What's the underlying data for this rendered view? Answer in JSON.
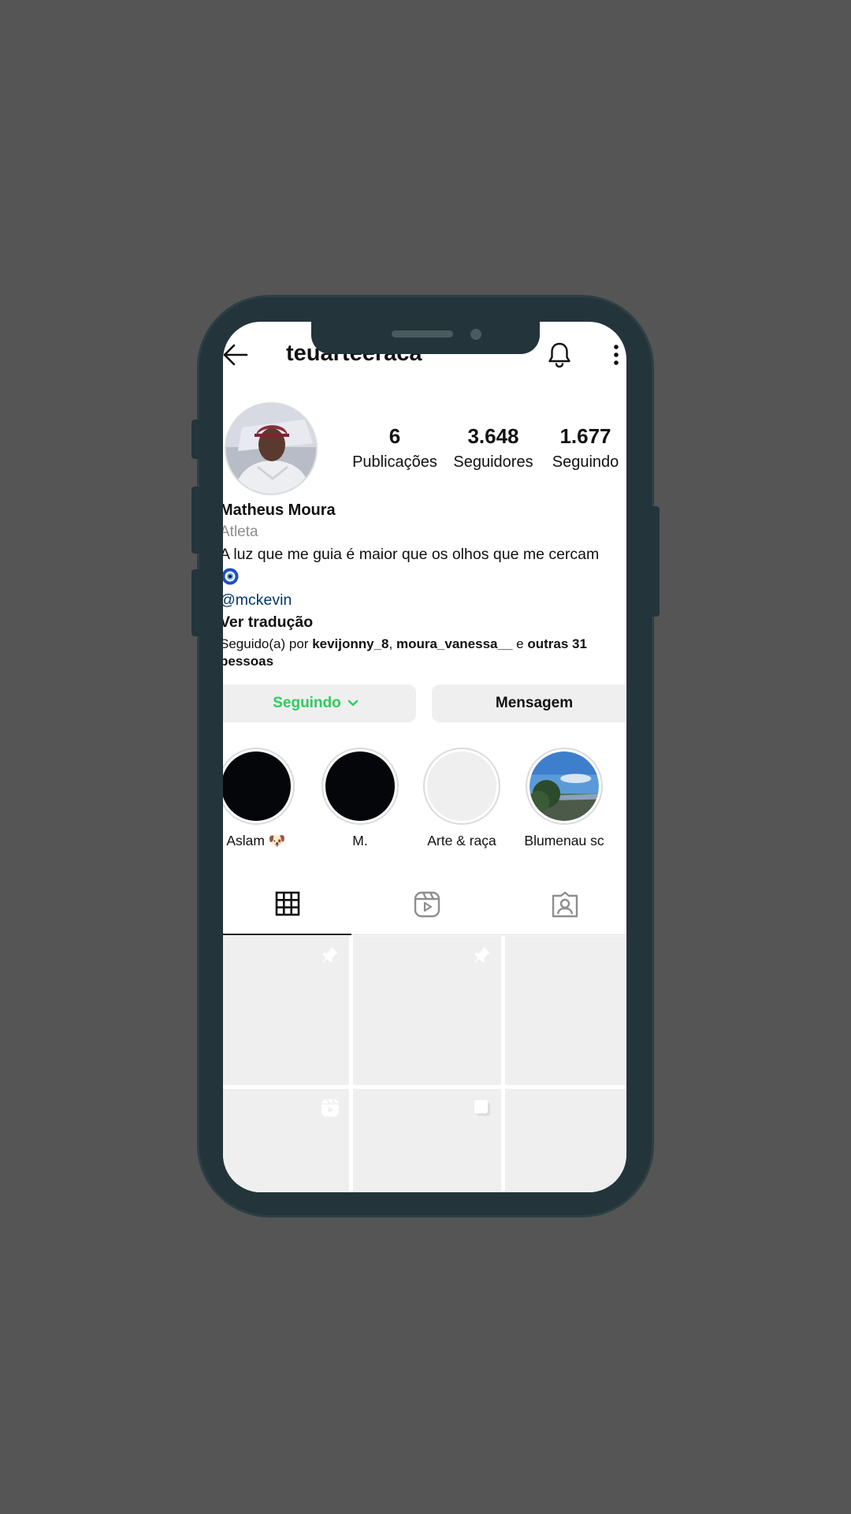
{
  "header": {
    "username": "teuarteeraca",
    "back_icon": "arrow-left-icon",
    "bell_icon": "bell-icon",
    "more_icon": "more-vertical-icon"
  },
  "profile": {
    "stats": [
      {
        "value": "6",
        "label": "Publicações"
      },
      {
        "value": "3.648",
        "label": "Seguidores"
      },
      {
        "value": "1.677",
        "label": "Seguindo"
      }
    ],
    "full_name": "Matheus Moura",
    "category": "Atleta",
    "bio": "A luz que me guia é maior que os olhos que me cercam",
    "bio_emoji": "evil-eye-icon",
    "mention": "@mckevin",
    "translate": "Ver tradução",
    "followed_by": {
      "prefix": "Seguido(a) por ",
      "user1": "kevijonny_8",
      "sep": ", ",
      "user2": "moura_vanessa__",
      "and": " e ",
      "others": "outras 31",
      "suffix": "pessoas"
    }
  },
  "actions": {
    "following_label": "Seguindo",
    "message_label": "Mensagem"
  },
  "highlights": [
    {
      "label": "Aslam 🐶",
      "color": "#05060a"
    },
    {
      "label": "M.",
      "color": "#05060a"
    },
    {
      "label": "Arte & raça",
      "color": "#efefef"
    },
    {
      "label": "Blumenau sc",
      "color": "#6a9fd6"
    }
  ],
  "tabs": [
    "grid-icon",
    "reels-icon",
    "tagged-icon"
  ],
  "colors": {
    "accent_green": "#2ecc5f",
    "link_blue": "#00376b",
    "frame": "#23353b",
    "background": "#555555"
  }
}
